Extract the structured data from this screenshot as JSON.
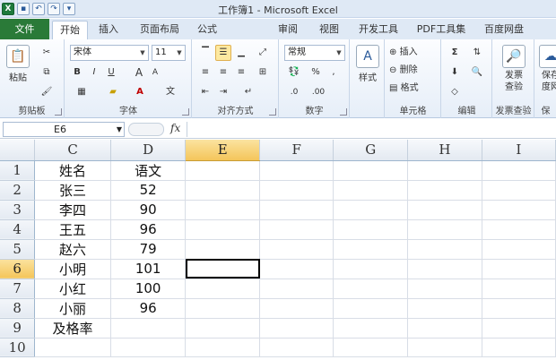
{
  "window": {
    "title": "工作簿1 - Microsoft Excel"
  },
  "tabs": {
    "file": "文件",
    "items": [
      "开始",
      "插入",
      "页面布局",
      "公式",
      "审阅",
      "视图",
      "开发工具",
      "PDF工具集",
      "百度网盘"
    ],
    "active": "开始"
  },
  "ribbon": {
    "clipboard": {
      "label": "剪贴板",
      "paste": "粘贴"
    },
    "font": {
      "label": "字体",
      "name": "宋体",
      "size": "11",
      "bold": "B",
      "italic": "I",
      "underline": "U",
      "grow": "A",
      "shrink": "A"
    },
    "alignment": {
      "label": "对齐方式"
    },
    "number": {
      "label": "数字",
      "format": "常规",
      "percent": "%",
      "comma": ","
    },
    "styles": {
      "label": "样式"
    },
    "cells": {
      "label": "单元格",
      "insert": "插入",
      "delete": "删除",
      "format": "格式"
    },
    "editing": {
      "label": "编辑"
    },
    "invoice": {
      "label": "发票查验",
      "button": "发票查验"
    },
    "save": {
      "label": "保",
      "button": "保存度网"
    }
  },
  "formula_bar": {
    "name_box": "E6",
    "fx": "fx",
    "formula": ""
  },
  "sheet": {
    "columns": [
      "C",
      "D",
      "E",
      "F",
      "G",
      "H",
      "I"
    ],
    "selected_column": "E",
    "selected_row": 6,
    "active_cell": "E6",
    "rows": [
      {
        "num": "1",
        "c": "姓名",
        "d": "语文"
      },
      {
        "num": "2",
        "c": "张三",
        "d": "52"
      },
      {
        "num": "3",
        "c": "李四",
        "d": "90"
      },
      {
        "num": "4",
        "c": "王五",
        "d": "96"
      },
      {
        "num": "5",
        "c": "赵六",
        "d": "79"
      },
      {
        "num": "6",
        "c": "小明",
        "d": "101"
      },
      {
        "num": "7",
        "c": "小红",
        "d": "100"
      },
      {
        "num": "8",
        "c": "小丽",
        "d": "96"
      },
      {
        "num": "9",
        "c": "及格率",
        "d": ""
      },
      {
        "num": "10",
        "c": "",
        "d": ""
      }
    ]
  }
}
